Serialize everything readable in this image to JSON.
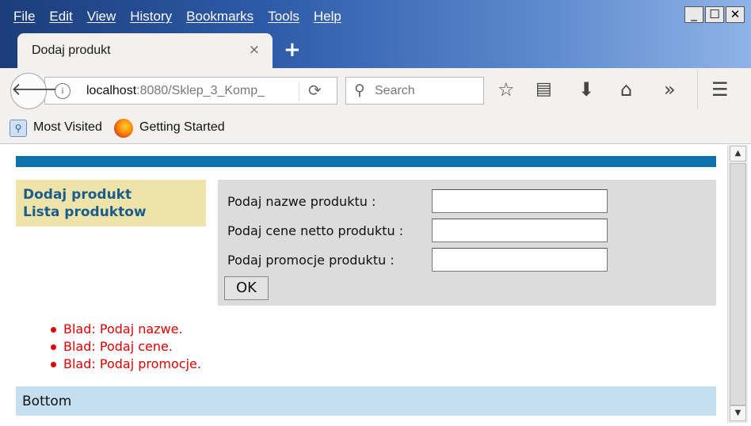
{
  "menu": [
    "File",
    "Edit",
    "View",
    "History",
    "Bookmarks",
    "Tools",
    "Help"
  ],
  "window_buttons": {
    "minimize": "_",
    "maximize": "☐",
    "close": "✕"
  },
  "tab": {
    "title": "Dodaj produkt",
    "close": "×"
  },
  "new_tab": "+",
  "url": {
    "host": "localhost",
    "rest": ":8080/Sklep_3_Komp_"
  },
  "search": {
    "placeholder": "Search"
  },
  "bookmarks": {
    "most_visited": "Most Visited",
    "getting_started": "Getting Started"
  },
  "page": {
    "sidebar": {
      "links": [
        "Dodaj produkt",
        "Lista produktow"
      ]
    },
    "form": {
      "name_label": "Podaj nazwe produktu :",
      "price_label": "Podaj cene netto produktu :",
      "promo_label": "Podaj promocje produktu :",
      "name_value": "",
      "price_value": "",
      "promo_value": "",
      "ok_label": "OK"
    },
    "errors": [
      "Blad: Podaj nazwe.",
      "Blad: Podaj cene.",
      "Blad: Podaj promocje."
    ],
    "bottom": "Bottom"
  },
  "colors": {
    "accent_bar": "#0b72aa",
    "sidebar_bg": "#eee4a9",
    "form_bg": "#dcdcdc",
    "error": "#e00000",
    "bottom_bg": "#c5dff0"
  },
  "icons": [
    "back-arrow-icon",
    "info-icon",
    "reload-icon",
    "search-icon",
    "star-icon",
    "reading-list-icon",
    "download-icon",
    "home-icon",
    "overflow-icon",
    "hamburger-menu-icon",
    "most-visited-icon",
    "firefox-icon"
  ]
}
